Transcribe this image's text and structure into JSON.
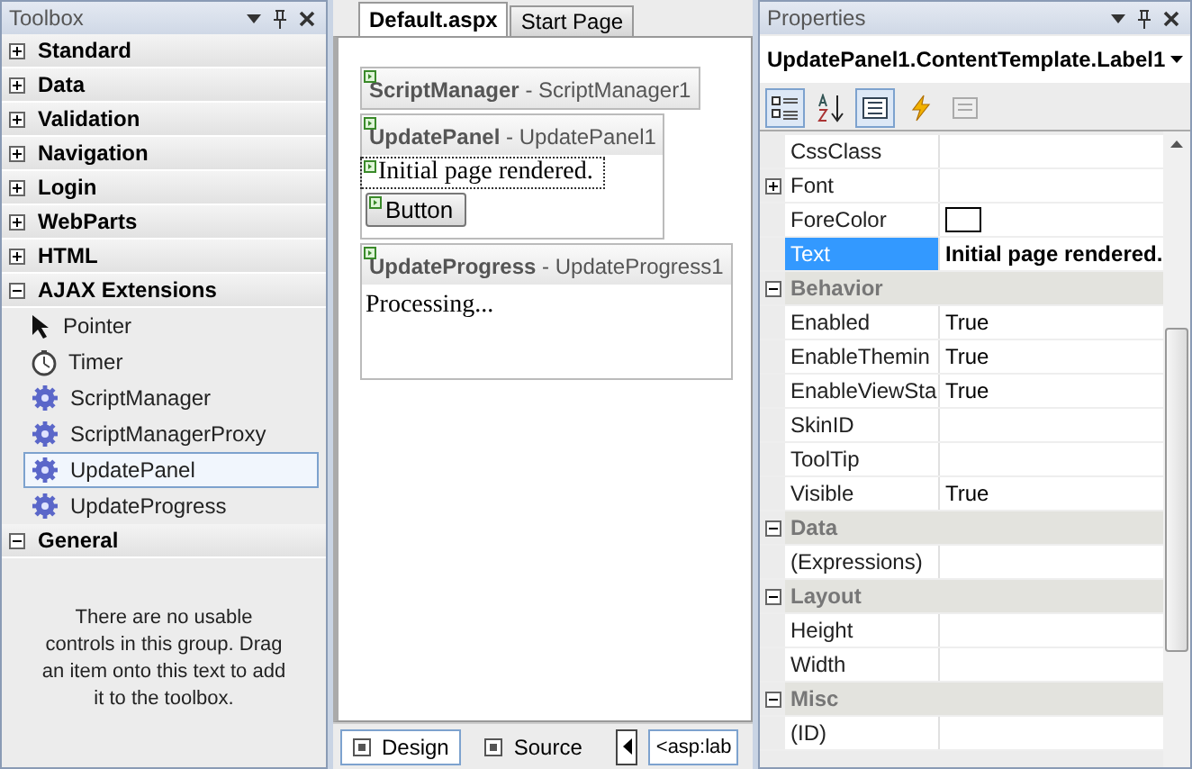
{
  "toolbox": {
    "title": "Toolbox",
    "groups": [
      {
        "label": "Standard",
        "expanded": false
      },
      {
        "label": "Data",
        "expanded": false
      },
      {
        "label": "Validation",
        "expanded": false
      },
      {
        "label": "Navigation",
        "expanded": false
      },
      {
        "label": "Login",
        "expanded": false
      },
      {
        "label": "WebParts",
        "expanded": false
      },
      {
        "label": "HTML",
        "expanded": false
      },
      {
        "label": "AJAX Extensions",
        "expanded": true,
        "items": [
          {
            "label": "Pointer",
            "kind": "pointer",
            "selected": false
          },
          {
            "label": "Timer",
            "kind": "timer",
            "selected": false
          },
          {
            "label": "ScriptManager",
            "kind": "component",
            "selected": false
          },
          {
            "label": "ScriptManagerProxy",
            "kind": "component",
            "selected": false
          },
          {
            "label": "UpdatePanel",
            "kind": "component",
            "selected": true
          },
          {
            "label": "UpdateProgress",
            "kind": "component",
            "selected": false
          }
        ]
      },
      {
        "label": "General",
        "expanded": true,
        "message": "There are no usable controls in this group. Drag an item onto this text to add it to the toolbox."
      }
    ]
  },
  "editor": {
    "tabs": [
      {
        "label": "Default.aspx",
        "selected": true
      },
      {
        "label": "Start Page",
        "selected": false
      }
    ],
    "controls": [
      {
        "kind": "script_manager",
        "header": "**ScriptManager** - ScriptManager1"
      },
      {
        "kind": "update_panel",
        "header": "**UpdatePanel** - UpdatePanel1",
        "label": "Initial page rendered.",
        "button": "Button"
      },
      {
        "kind": "update_progress",
        "header": "**UpdateProgress** - UpdateProgress1",
        "content": "Processing..."
      }
    ],
    "views": [
      {
        "label": "Design",
        "selected": true
      },
      {
        "label": "Source",
        "selected": false
      }
    ],
    "breadcrumb": "<asp:lab"
  },
  "properties": {
    "title": "Properties",
    "object": "UpdatePanel1.ContentTemplate.Label1",
    "toolbar": [
      {
        "kind": "categorized",
        "selected": true
      },
      {
        "kind": "alphabetical",
        "selected": false
      },
      {
        "kind": "properties",
        "selected": true
      },
      {
        "kind": "events",
        "selected": false
      },
      {
        "kind": "pages",
        "selected": false
      }
    ],
    "rows": [
      {
        "kind": "property",
        "name": "CssClass",
        "selected": false
      },
      {
        "kind": "property",
        "name": "Font",
        "expanded": false,
        "selected": false
      },
      {
        "kind": "color",
        "name": "ForeColor",
        "selected": false
      },
      {
        "kind": "property",
        "name": "Text",
        "value": "Initial page rendered.",
        "selected": true
      },
      {
        "kind": "category",
        "name": "Behavior",
        "expanded": true
      },
      {
        "kind": "property",
        "name": "Enabled",
        "value": "True",
        "selected": false
      },
      {
        "kind": "property",
        "name": "EnableThemin",
        "value": "True",
        "selected": false
      },
      {
        "kind": "property",
        "name": "EnableViewSta",
        "value": "True",
        "selected": false
      },
      {
        "kind": "property",
        "name": "SkinID",
        "selected": false
      },
      {
        "kind": "property",
        "name": "ToolTip",
        "selected": false
      },
      {
        "kind": "property",
        "name": "Visible",
        "value": "True",
        "selected": false
      },
      {
        "kind": "category",
        "name": "Data",
        "expanded": true
      },
      {
        "kind": "property",
        "name": "(Expressions)",
        "selected": false
      },
      {
        "kind": "category",
        "name": "Layout",
        "expanded": true
      },
      {
        "kind": "property",
        "name": "Height",
        "selected": false
      },
      {
        "kind": "property",
        "name": "Width",
        "selected": false
      },
      {
        "kind": "category",
        "name": "Misc",
        "expanded": true
      },
      {
        "kind": "property",
        "name": "(ID)",
        "selected": false
      }
    ]
  }
}
